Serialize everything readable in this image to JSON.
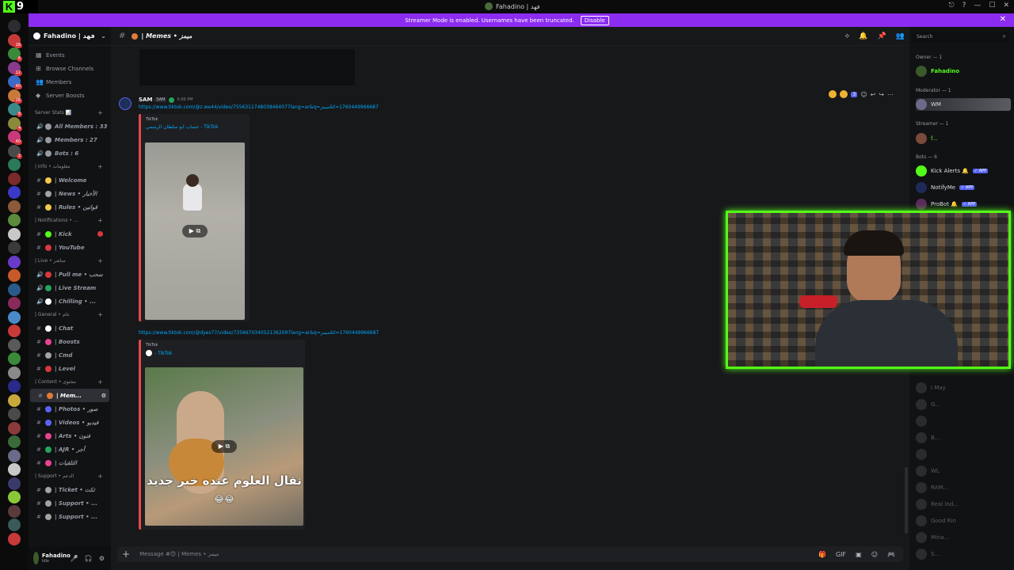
{
  "titlebar": {
    "logo_letter": "K",
    "logo_number": "9",
    "title": "Fahadino | فهد",
    "controls": [
      "⎋",
      "?",
      "—",
      "☐",
      "✕"
    ]
  },
  "banner": {
    "text": "Streamer Mode is enabled. Usernames have been truncated.",
    "button": "Disable",
    "close": "✕"
  },
  "server_badges": [
    "12",
    "18",
    "6",
    "12",
    "40",
    "26",
    "8",
    "4",
    "40",
    "2"
  ],
  "guild": {
    "name": "Fahadino | فهد",
    "chevron": "⌄"
  },
  "nav": [
    {
      "icon": "▦",
      "label": "Events"
    },
    {
      "icon": "⊞",
      "label": "Browse Channels"
    },
    {
      "icon": "👥",
      "label": "Members"
    },
    {
      "icon": "◆",
      "label": "Server Boosts"
    }
  ],
  "categories": [
    {
      "label": "Server Stats 📊",
      "channels": [
        {
          "icon": "🔊",
          "name": "All Members : 33",
          "color": "#949ba4"
        },
        {
          "icon": "🔊",
          "name": "Members : 27",
          "color": "#949ba4"
        },
        {
          "icon": "🔊",
          "name": "Bots : 6",
          "color": "#949ba4"
        }
      ]
    },
    {
      "label": "| Info • معلومات",
      "channels": [
        {
          "icon": "#",
          "name": "| Welcome",
          "color": "#f2c94c"
        },
        {
          "icon": "#",
          "name": "| News • الأخبار",
          "color": "#a3a3a3"
        },
        {
          "icon": "#",
          "name": "| Rules • قوانين",
          "color": "#f2c94c"
        }
      ]
    },
    {
      "label": "| Notifications • ...",
      "channels": [
        {
          "icon": "#",
          "name": "| Kick",
          "color": "#53fc18"
        },
        {
          "icon": "#",
          "name": "| YouTube",
          "color": "#da373c"
        }
      ]
    },
    {
      "label": "| Live • مباشر",
      "channels": [
        {
          "icon": "🔊",
          "name": "| Pull me • سحب",
          "color": "#da373c"
        },
        {
          "icon": "🔊",
          "name": "| Live Stream",
          "color": "#23a55a"
        },
        {
          "icon": "🔊",
          "name": "| Chilling • ...",
          "color": "#ffffff"
        }
      ]
    },
    {
      "label": "| General • عام",
      "channels": [
        {
          "icon": "#",
          "name": "| Chat",
          "color": "#ffffff"
        },
        {
          "icon": "#",
          "name": "| Boosts",
          "color": "#e84393"
        },
        {
          "icon": "#",
          "name": "| Cmd",
          "color": "#a3a3a3"
        },
        {
          "icon": "#",
          "name": "| Level",
          "color": "#da373c"
        }
      ]
    },
    {
      "label": "| Content • محتوى",
      "channels": [
        {
          "icon": "#",
          "name": "| Mem...",
          "color": "#e07b39",
          "active": true
        },
        {
          "icon": "#",
          "name": "| Photos • صور",
          "color": "#5865f2"
        },
        {
          "icon": "#",
          "name": "| Videos • فيديو",
          "color": "#5865f2"
        },
        {
          "icon": "#",
          "name": "| Arts • فنون",
          "color": "#e84393"
        },
        {
          "icon": "#",
          "name": "| AJR • أجر",
          "color": "#23a55a"
        },
        {
          "icon": "#",
          "name": "| التلقيات",
          "color": "#e84393"
        }
      ]
    },
    {
      "label": "| Support • الدعم",
      "channels": [
        {
          "icon": "#",
          "name": "| Ticket • تكت",
          "color": "#a3a3a3"
        },
        {
          "icon": "#",
          "name": "| Support • ...",
          "color": "#a3a3a3"
        },
        {
          "icon": "#",
          "name": "| Support • ...",
          "color": "#a3a3a3"
        }
      ]
    }
  ],
  "user": {
    "name": "Fahadino",
    "status": "Idle",
    "controls": [
      "🎤",
      "🎧",
      "⚙"
    ]
  },
  "channel_header": {
    "name": "| Memes • ميمز",
    "tools": [
      "⟡",
      "🔔",
      "📌",
      "👥"
    ]
  },
  "search": {
    "placeholder": "Search",
    "icon": "⌕"
  },
  "message": {
    "author": "SAM",
    "tag": "SAM",
    "time": "5:00 PM",
    "link1": "https://www.tiktok.com/@z.we44/video/7556311748038464077lang=ar&q=ميمز&t=1760449966687",
    "embed1": {
      "provider": "TikTok",
      "title": "حساب ابو سلطان الرسمي - TikTok"
    },
    "link2": "https://www.tiktok.com/@dyes77/video/7356670340521362097lang=ar&q=ميمز&t=1760449966687",
    "embed2": {
      "provider": "TikTok",
      "title": "- TikTok",
      "caption": "نقال العلوم عنده خبر جديد",
      "emoji": "😂😂"
    },
    "play": "▶ ⧉",
    "reactions_count": "3"
  },
  "composer": {
    "placeholder": "Message #😊 | Memes • ميمز",
    "plus": "+",
    "tools": [
      "🎁",
      "GIF",
      "▣",
      "☺",
      "🎮"
    ]
  },
  "members": {
    "groups": [
      {
        "label": "Owner — 1"
      },
      {
        "label": "Moderator — 1"
      },
      {
        "label": "Streamer — 1"
      },
      {
        "label": "Bots — 6"
      }
    ],
    "items": [
      {
        "name": "Fahadino",
        "color": "#23a55a"
      },
      {
        "name": "WM",
        "color": "#dbdee1"
      },
      {
        "name": "f...",
        "color": "#23a55a"
      },
      {
        "name": "Kick Alerts 🔔",
        "color": "#dbdee1",
        "app": "✓ APP"
      },
      {
        "name": "NotifyMe",
        "color": "#dbdee1",
        "app": "✓ APP"
      },
      {
        "name": "ProBot 🔔",
        "color": "#dbdee1",
        "app": "✓ APP"
      }
    ],
    "faded": [
      "I May",
      "G...",
      "",
      "B...",
      "",
      "WL",
      "RAM...",
      "Real Ind...",
      "Good Rin",
      "Mina...",
      "S..."
    ]
  },
  "colors": {
    "kick_green": "#53fc18",
    "banner": "#8c2cf0",
    "link": "#00a8fc"
  }
}
